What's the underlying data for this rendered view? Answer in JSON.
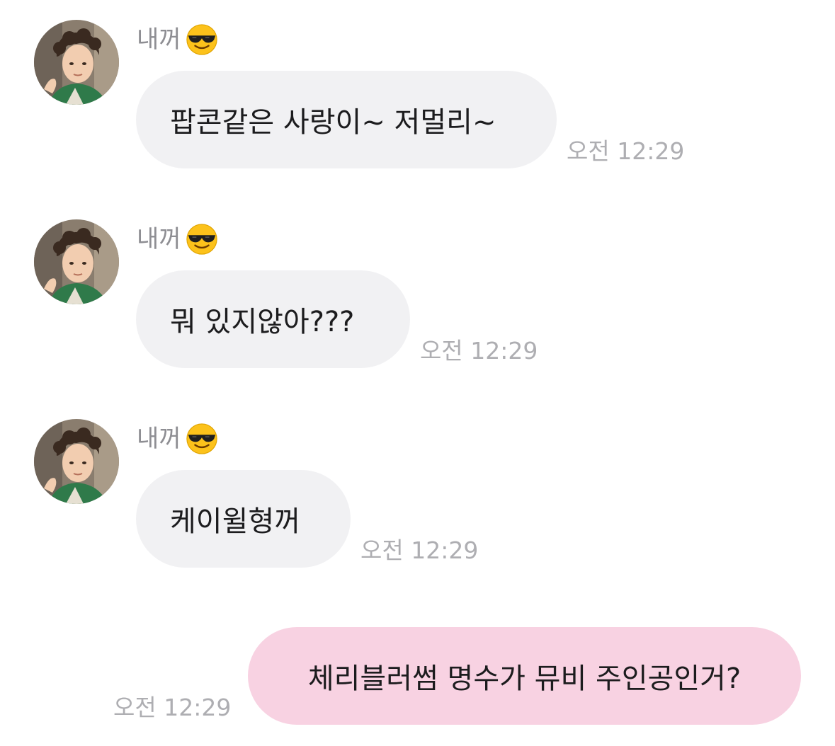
{
  "messages": [
    {
      "sender": "내꺼",
      "sender_emoji": "smiling-face-with-sunglasses",
      "text": "팝콘같은 사랑이~ 저멀리~",
      "time": "오전 12:29"
    },
    {
      "sender": "내꺼",
      "sender_emoji": "smiling-face-with-sunglasses",
      "text": "뭐 있지않아???",
      "time": "오전 12:29"
    },
    {
      "sender": "내꺼",
      "sender_emoji": "smiling-face-with-sunglasses",
      "text": "케이윌형꺼",
      "time": "오전 12:29"
    }
  ],
  "outgoing": {
    "text": "체리블러썸 명수가 뮤비 주인공인거?",
    "time": "오전 12:29"
  },
  "colors": {
    "incoming_bubble": "#f1f1f3",
    "outgoing_bubble": "#f8d2e2",
    "timestamp": "#aeaeb2",
    "sender_name": "#8e8e93"
  }
}
